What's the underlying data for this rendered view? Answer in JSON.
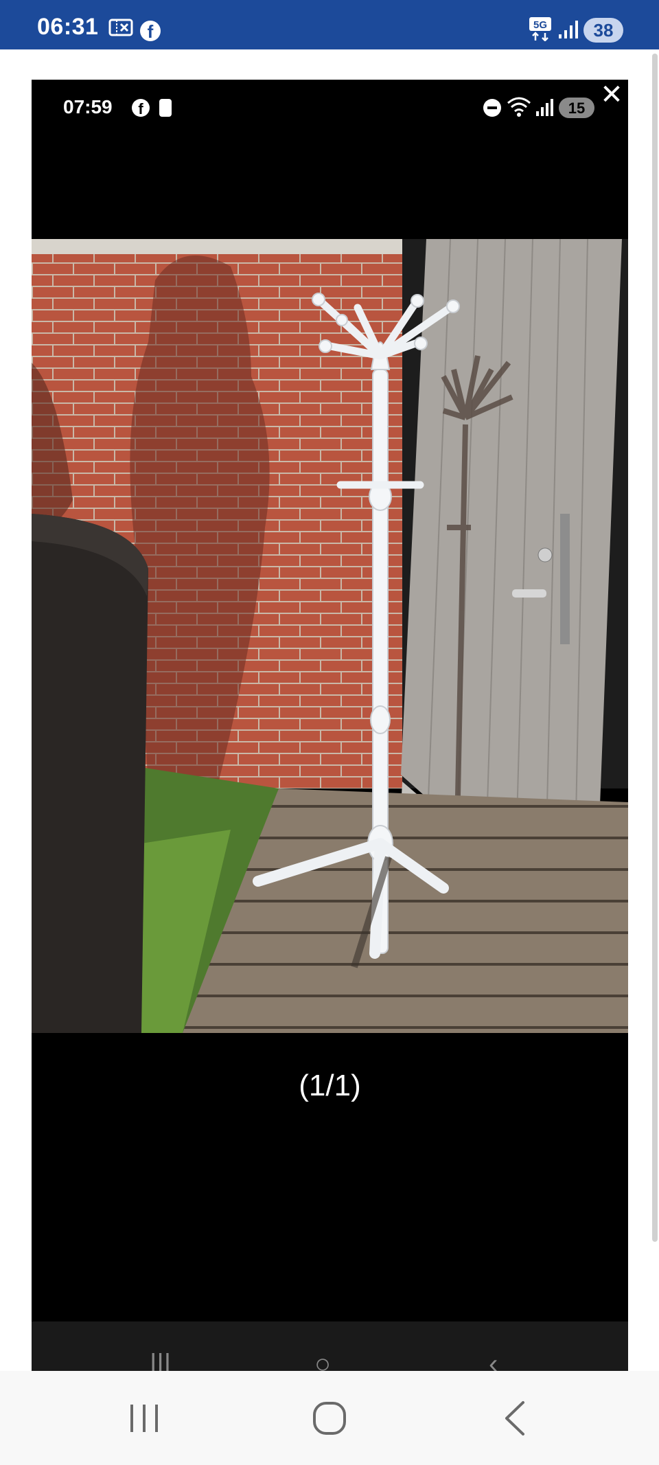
{
  "status_bar": {
    "time": "06:31",
    "icons": [
      "ticket-icon",
      "facebook-icon",
      "5g-icon",
      "signal-icon"
    ],
    "battery": "38",
    "bg_color": "#1c4a9a"
  },
  "viewer": {
    "inner_status": {
      "time": "07:59",
      "icons": [
        "facebook-icon",
        "lock-icon",
        "do-not-disturb-icon",
        "wifi-icon",
        "signal-icon"
      ],
      "battery": "15"
    },
    "close_icon": "close-icon",
    "image_subject": "white-coat-rack",
    "counter": "(1/1)"
  },
  "nav": {
    "recent_icon": "recent-apps-icon",
    "home_icon": "home-icon",
    "back_icon": "back-icon"
  }
}
